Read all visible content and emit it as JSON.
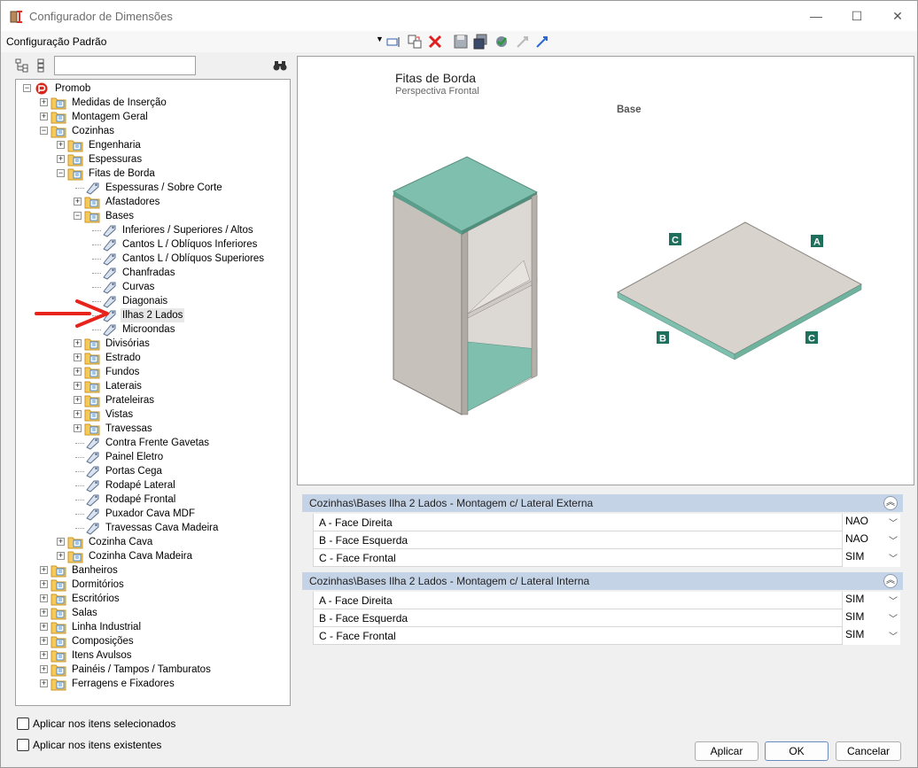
{
  "window": {
    "title": "Configurador de Dimensões",
    "minimize": "—",
    "maximize": "☐",
    "close": "✕"
  },
  "toolbar": {
    "config_name": "Configuração Padrão"
  },
  "tree": {
    "items": [
      {
        "label": "Promob",
        "level": 0,
        "icon": "promob-logo-icon",
        "expander": "minus"
      },
      {
        "label": "Medidas de Inserção",
        "level": 1,
        "icon": "folder-icon",
        "expander": "plus"
      },
      {
        "label": "Montagem Geral",
        "level": 1,
        "icon": "folder-icon",
        "expander": "plus"
      },
      {
        "label": "Cozinhas",
        "level": 1,
        "icon": "folder-icon",
        "expander": "minus"
      },
      {
        "label": "Engenharia",
        "level": 2,
        "icon": "folder-icon",
        "expander": "plus"
      },
      {
        "label": "Espessuras",
        "level": 2,
        "icon": "folder-icon",
        "expander": "plus"
      },
      {
        "label": "Fitas de Borda",
        "level": 2,
        "icon": "folder-icon",
        "expander": "minus"
      },
      {
        "label": "Espessuras / Sobre Corte",
        "level": 3,
        "icon": "tag-icon",
        "expander": ""
      },
      {
        "label": "Afastadores",
        "level": 3,
        "icon": "folder-icon",
        "expander": "plus"
      },
      {
        "label": "Bases",
        "level": 3,
        "icon": "folder-icon",
        "expander": "minus"
      },
      {
        "label": "Inferiores / Superiores / Altos",
        "level": 4,
        "icon": "tag-icon",
        "expander": ""
      },
      {
        "label": "Cantos L / Oblíquos Inferiores",
        "level": 4,
        "icon": "tag-icon",
        "expander": ""
      },
      {
        "label": "Cantos L / Oblíquos Superiores",
        "level": 4,
        "icon": "tag-icon",
        "expander": ""
      },
      {
        "label": "Chanfradas",
        "level": 4,
        "icon": "tag-icon",
        "expander": ""
      },
      {
        "label": "Curvas",
        "level": 4,
        "icon": "tag-icon",
        "expander": ""
      },
      {
        "label": "Diagonais",
        "level": 4,
        "icon": "tag-icon",
        "expander": ""
      },
      {
        "label": "Ilhas 2 Lados",
        "level": 4,
        "icon": "tag-icon",
        "expander": "",
        "selected": true
      },
      {
        "label": "Microondas",
        "level": 4,
        "icon": "tag-icon",
        "expander": ""
      },
      {
        "label": "Divisórias",
        "level": 3,
        "icon": "folder-icon",
        "expander": "plus"
      },
      {
        "label": "Estrado",
        "level": 3,
        "icon": "folder-icon",
        "expander": "plus"
      },
      {
        "label": "Fundos",
        "level": 3,
        "icon": "folder-icon",
        "expander": "plus"
      },
      {
        "label": "Laterais",
        "level": 3,
        "icon": "folder-icon",
        "expander": "plus"
      },
      {
        "label": "Prateleiras",
        "level": 3,
        "icon": "folder-icon",
        "expander": "plus"
      },
      {
        "label": "Vistas",
        "level": 3,
        "icon": "folder-icon",
        "expander": "plus"
      },
      {
        "label": "Travessas",
        "level": 3,
        "icon": "folder-icon",
        "expander": "plus"
      },
      {
        "label": "Contra Frente Gavetas",
        "level": 3,
        "icon": "tag-icon",
        "expander": ""
      },
      {
        "label": "Painel Eletro",
        "level": 3,
        "icon": "tag-icon",
        "expander": ""
      },
      {
        "label": "Portas Cega",
        "level": 3,
        "icon": "tag-icon",
        "expander": ""
      },
      {
        "label": "Rodapé Lateral",
        "level": 3,
        "icon": "tag-icon",
        "expander": ""
      },
      {
        "label": "Rodapé Frontal",
        "level": 3,
        "icon": "tag-icon",
        "expander": ""
      },
      {
        "label": "Puxador Cava MDF",
        "level": 3,
        "icon": "tag-icon",
        "expander": ""
      },
      {
        "label": "Travessas Cava Madeira",
        "level": 3,
        "icon": "tag-icon",
        "expander": ""
      },
      {
        "label": "Cozinha Cava",
        "level": 2,
        "icon": "folder-icon",
        "expander": "plus"
      },
      {
        "label": "Cozinha Cava Madeira",
        "level": 2,
        "icon": "folder-icon",
        "expander": "plus"
      },
      {
        "label": "Banheiros",
        "level": 1,
        "icon": "folder-icon",
        "expander": "plus"
      },
      {
        "label": "Dormitórios",
        "level": 1,
        "icon": "folder-icon",
        "expander": "plus"
      },
      {
        "label": "Escritórios",
        "level": 1,
        "icon": "folder-icon",
        "expander": "plus"
      },
      {
        "label": "Salas",
        "level": 1,
        "icon": "folder-icon",
        "expander": "plus"
      },
      {
        "label": "Linha Industrial",
        "level": 1,
        "icon": "folder-icon",
        "expander": "plus"
      },
      {
        "label": "Composições",
        "level": 1,
        "icon": "folder-icon",
        "expander": "plus"
      },
      {
        "label": "Itens Avulsos",
        "level": 1,
        "icon": "folder-icon",
        "expander": "plus"
      },
      {
        "label": "Painéis / Tampos / Tamburatos",
        "level": 1,
        "icon": "folder-icon",
        "expander": "plus"
      },
      {
        "label": "Ferragens e Fixadores",
        "level": 1,
        "icon": "folder-icon",
        "expander": "plus"
      }
    ]
  },
  "preview": {
    "title": "Fitas de Borda",
    "subtitle": "Perspectiva Frontal",
    "caption": "Base",
    "edge_labels": {
      "top_left": "C",
      "top_right": "A",
      "bottom_left": "B",
      "bottom_right": "C"
    },
    "colors": {
      "edge_band": "#7ebfae",
      "panel": "#d8d3cd",
      "label_bg": "#1e6f5c"
    }
  },
  "groups": [
    {
      "title": "Cozinhas\\Bases Ilha 2 Lados - Montagem c/ Lateral Externa",
      "rows": [
        {
          "label": "A - Face Direita",
          "value": "NAO"
        },
        {
          "label": "B - Face Esquerda",
          "value": "NAO"
        },
        {
          "label": "C - Face Frontal",
          "value": "SIM"
        }
      ]
    },
    {
      "title": "Cozinhas\\Bases Ilha 2 Lados - Montagem c/ Lateral Interna",
      "rows": [
        {
          "label": "A - Face Direita",
          "value": "SIM"
        },
        {
          "label": "B - Face Esquerda",
          "value": "SIM"
        },
        {
          "label": "C - Face Frontal",
          "value": "SIM"
        }
      ]
    }
  ],
  "options": {
    "apply_selected": "Aplicar nos itens selecionados",
    "apply_existing": "Aplicar nos itens existentes"
  },
  "buttons": {
    "apply": "Aplicar",
    "ok": "OK",
    "cancel": "Cancelar"
  }
}
